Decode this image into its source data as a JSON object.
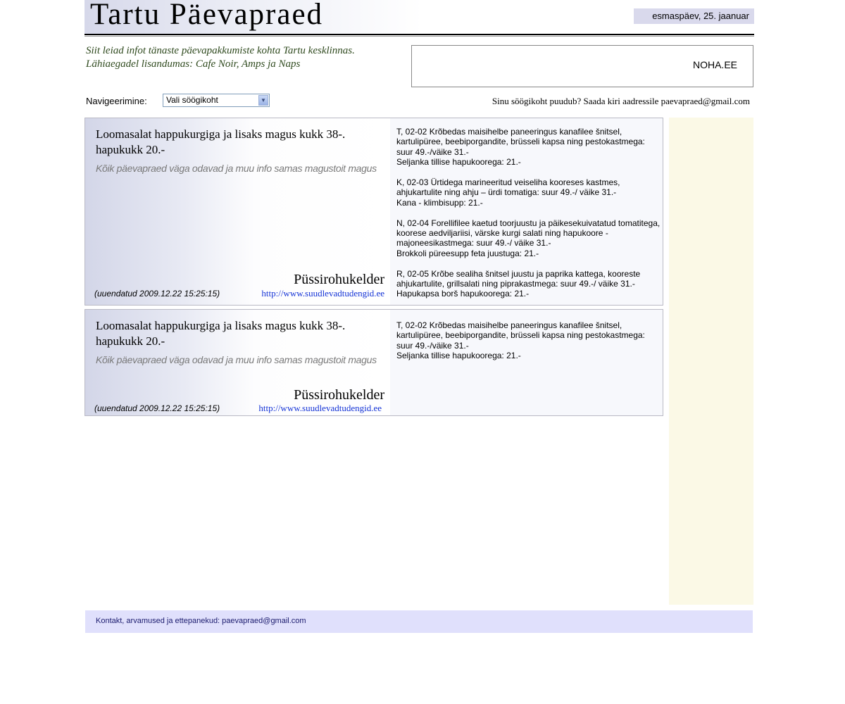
{
  "header": {
    "site_title": "Tartu Päevapraed",
    "date": "esmaspäev, 25. jaanuar"
  },
  "intro": {
    "line1": "Siit leiad infot tänaste päevapakkumiste kohta Tartu kesklinnas.",
    "line2": "Lähiaegadel lisandumas: Cafe Noir, Amps ja Naps"
  },
  "ad": {
    "text": "NOHA.EE"
  },
  "nav": {
    "label": "Navigeerimine:",
    "select_value": "Vali söögikoht",
    "missing_note": "Sinu söögikoht puudub? Saada kiri aadressile paevapraed@gmail.com"
  },
  "cards": [
    {
      "deal": "Loomasalat happukurgiga ja lisaks magus kukk 38-. hapukukk 20.-",
      "subtitle": "Kõik päevapraed väga odavad ja muu info samas magustoit magus",
      "restaurant": "Püssirohukelder",
      "updated": "(uuendatud 2009.12.22 15:25:15)",
      "link": "http://www.suudlevadtudengid.ee",
      "menu": [
        "T, 02-02 Krõbedas maisihelbe paneeringus kanafilee šnitsel, kartulipüree, beebiporgandite, brüsseli kapsa ning pestokastmega: suur 49.-/väike 31.-",
        "Seljanka tillise hapukoorega: 21.-",
        "",
        "K, 02-03 Ürtidega marineeritud veiseliha kooreses kastmes, ahjukartulite ning ahju – ürdi tomatiga: suur 49.-/ väike 31.-",
        "Kana - klimbisupp: 21.-",
        "",
        "N, 02-04 Forellifilee kaetud toorjuustu ja päikesekuivatatud tomatitega, koorese aedviljariisi, värske kurgi salati ning hapukoore - majoneesikastmega: suur 49.-/ väike 31.-",
        "Brokkoli püreesupp feta juustuga: 21.-",
        "",
        "R, 02-05 Krõbe sealiha šnitsel juustu ja paprika kattega, kooreste ahjukartulite, grillsalati ning piprakastmega: suur 49.-/ väike 31.-",
        "Hapukapsa borš hapukoorega: 21.-"
      ]
    },
    {
      "deal": "Loomasalat happukurgiga ja lisaks magus kukk 38-. hapukukk 20.-",
      "subtitle": "Kõik päevapraed väga odavad ja muu info samas magustoit magus",
      "restaurant": "Püssirohukelder",
      "updated": "(uuendatud 2009.12.22 15:25:15)",
      "link": "http://www.suudlevadtudengid.ee",
      "menu": [
        "T, 02-02 Krõbedas maisihelbe paneeringus kanafilee šnitsel, kartulipüree, beebiporgandite, brüsseli kapsa ning pestokastmega: suur 49.-/väike 31.-",
        "Seljanka tillise hapukoorega: 21.-"
      ]
    }
  ],
  "footer": {
    "text": "Kontakt, arvamused ja ettepanekud: paevapraed@gmail.com"
  }
}
